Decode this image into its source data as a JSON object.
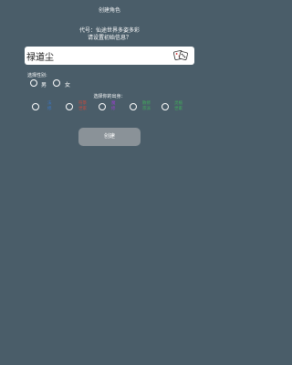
{
  "header": {
    "title": "创建角色"
  },
  "intro": {
    "code_line": "代号：仙途世界多姿多彩",
    "prompt_line": "请设置初始信息？"
  },
  "name": {
    "value": "禄道尘",
    "dice_icon": "dice-icon"
  },
  "gender": {
    "label": "选择性别:",
    "options": [
      {
        "label": "男",
        "selected": false
      },
      {
        "label": "女",
        "selected": false
      }
    ]
  },
  "origin": {
    "label": "选择你的出身：",
    "options": [
      {
        "line1": "法",
        "line2": "修",
        "color": "#3a78c8"
      },
      {
        "line1": "符箓",
        "line2": "世家",
        "color": "#c84a3c"
      },
      {
        "line1": "魔",
        "line2": "修",
        "color": "#9b3fd0"
      },
      {
        "line1": "散修",
        "line2": "宗派",
        "color": "#3fae5a"
      },
      {
        "line1": "灵植",
        "line2": "世家",
        "color": "#3fae5a"
      }
    ]
  },
  "actions": {
    "create_label": "创建"
  }
}
